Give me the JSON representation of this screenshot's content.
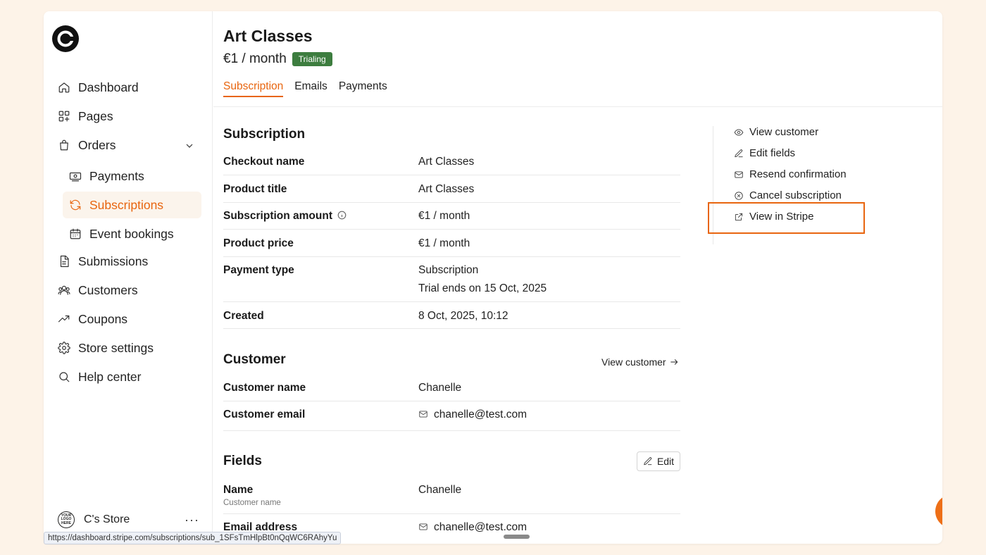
{
  "brand": {
    "accent": "#e8650f",
    "badge_color": "#3d7d3f"
  },
  "sidebar": {
    "logo_icon": "store-logo-icon",
    "items": [
      {
        "label": "Dashboard",
        "icon": "home-icon"
      },
      {
        "label": "Pages",
        "icon": "pages-grid-icon"
      },
      {
        "label": "Orders",
        "icon": "shopping-bag-icon"
      },
      {
        "label": "Payments",
        "icon": "banknote-icon"
      },
      {
        "label": "Subscriptions",
        "icon": "refresh-icon"
      },
      {
        "label": "Event bookings",
        "icon": "calendar-icon"
      },
      {
        "label": "Submissions",
        "icon": "document-icon"
      },
      {
        "label": "Customers",
        "icon": "users-icon"
      },
      {
        "label": "Coupons",
        "icon": "trend-icon"
      },
      {
        "label": "Store settings",
        "icon": "gear-icon"
      },
      {
        "label": "Help center",
        "icon": "search-icon"
      }
    ],
    "store_name": "C's Store",
    "store_avatar_text": "YOUR LOGO HERE",
    "more_label": "···"
  },
  "header": {
    "title": "Art Classes",
    "price": "€1 / month",
    "status_badge": "Trialing",
    "tabs": [
      {
        "label": "Subscription",
        "active": true
      },
      {
        "label": "Emails",
        "active": false
      },
      {
        "label": "Payments",
        "active": false
      }
    ]
  },
  "subscription": {
    "title": "Subscription",
    "rows": [
      {
        "label": "Checkout name",
        "value": "Art Classes"
      },
      {
        "label": "Product title",
        "value": "Art Classes"
      },
      {
        "label": "Subscription amount",
        "value": "€1 / month"
      },
      {
        "label": "Product price",
        "value": "€1 / month"
      },
      {
        "label": "Payment type",
        "value": "Subscription",
        "value2": "Trial ends on 15 Oct, 2025"
      },
      {
        "label": "Created",
        "value": "8 Oct, 2025, 10:12"
      }
    ]
  },
  "customer": {
    "title": "Customer",
    "link_label": "View customer",
    "rows": [
      {
        "label": "Customer name",
        "value": "Chanelle"
      },
      {
        "label": "Customer email",
        "value": "chanelle@test.com"
      }
    ]
  },
  "fields": {
    "title": "Fields",
    "edit_label": "Edit",
    "rows": [
      {
        "label": "Name",
        "sublabel": "Customer name",
        "value": "Chanelle"
      },
      {
        "label": "Email address",
        "value": "chanelle@test.com"
      }
    ]
  },
  "actions": [
    {
      "label": "View customer",
      "icon": "eye-icon"
    },
    {
      "label": "Edit fields",
      "icon": "pencil-icon"
    },
    {
      "label": "Resend confirmation",
      "icon": "mail-icon"
    },
    {
      "label": "Cancel subscription",
      "icon": "x-circle-icon"
    },
    {
      "label": "View in Stripe",
      "icon": "external-link-icon",
      "highlighted": true
    }
  ],
  "status_bar": {
    "url": "https://dashboard.stripe.com/subscriptions/sub_1SFsTmHlpBt0nQqWC6RAhyYu"
  }
}
